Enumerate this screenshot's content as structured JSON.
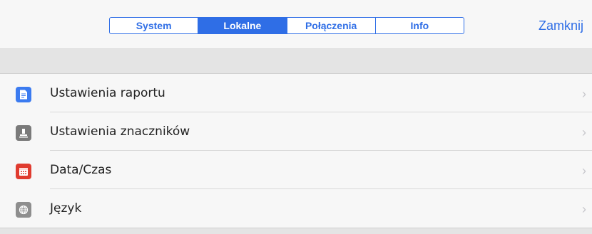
{
  "tabs": [
    {
      "label": "System",
      "active": false
    },
    {
      "label": "Lokalne",
      "active": true
    },
    {
      "label": "Połączenia",
      "active": false
    },
    {
      "label": "Info",
      "active": false
    }
  ],
  "close_label": "Zamknij",
  "colors": {
    "accent": "#2f6ee6",
    "report_icon": "#3b7bf0",
    "markers_icon": "#7a7a7a",
    "datetime_icon": "#e03b2f",
    "language_icon": "#8e8e8e"
  },
  "items": [
    {
      "label": "Ustawienia raportu",
      "icon": "document-icon",
      "chevron": "›"
    },
    {
      "label": "Ustawienia znaczników",
      "icon": "stamp-icon",
      "chevron": "›"
    },
    {
      "label": "Data/Czas",
      "icon": "calendar-icon",
      "chevron": "›"
    },
    {
      "label": "Język",
      "icon": "globe-icon",
      "chevron": "›"
    }
  ]
}
